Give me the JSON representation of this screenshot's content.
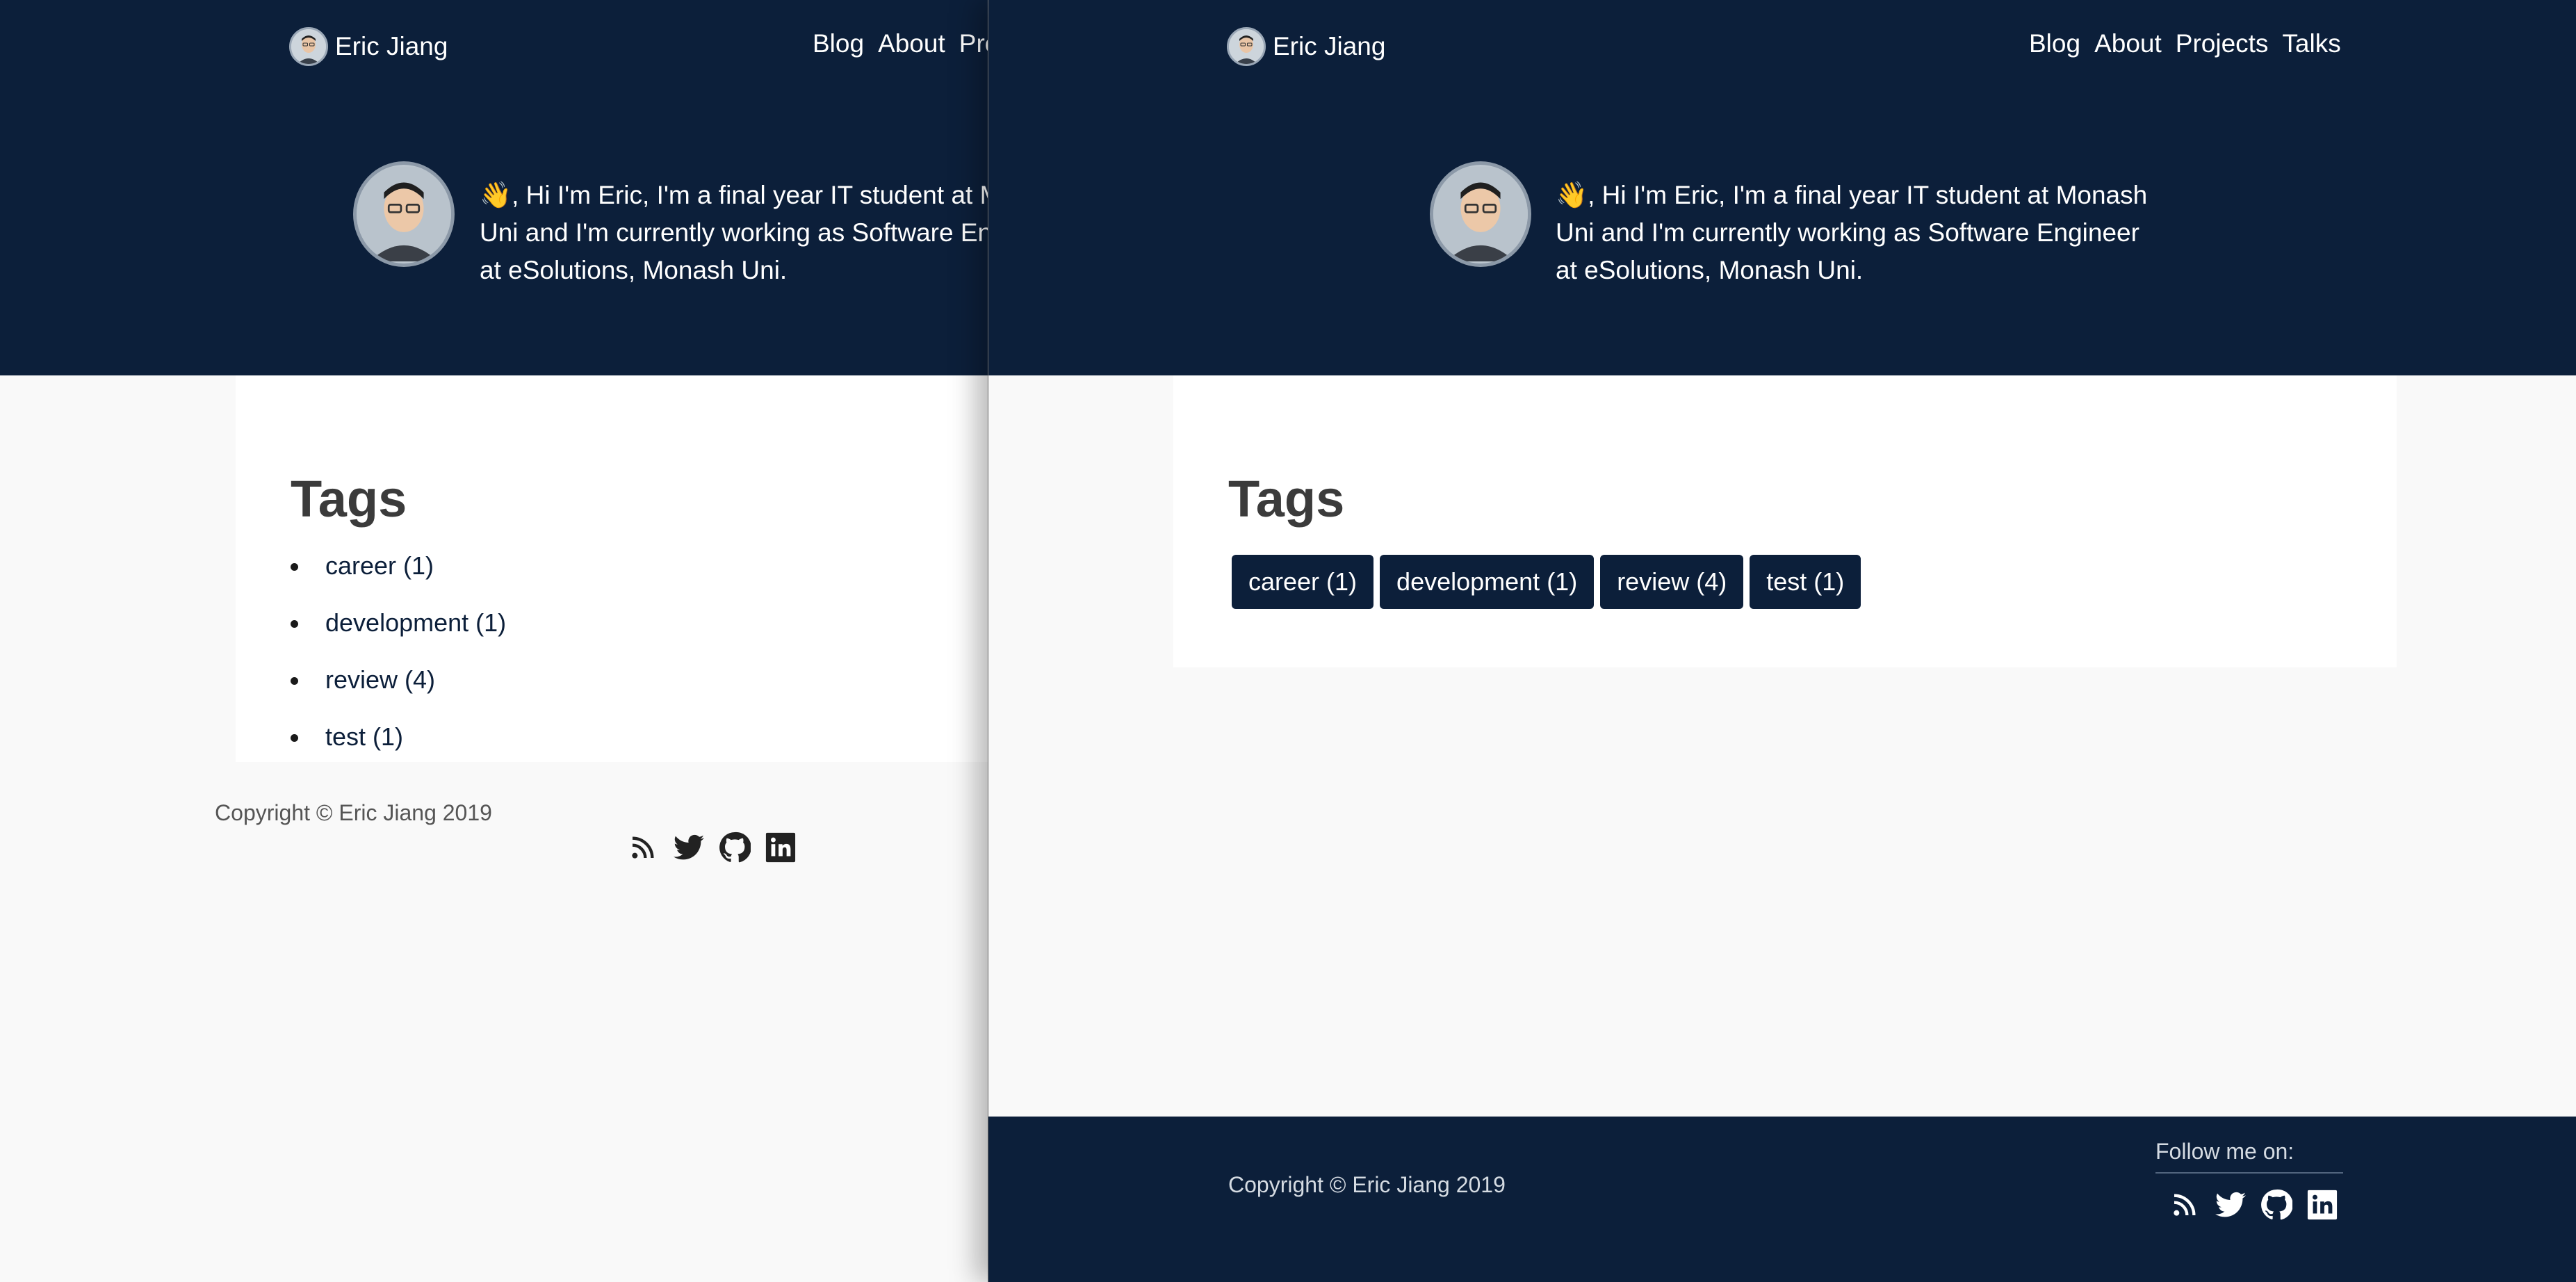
{
  "brand": {
    "name": "Eric Jiang"
  },
  "nav": {
    "before": [
      "Blog",
      "About",
      "Pro"
    ],
    "after": [
      "Blog",
      "About",
      "Projects",
      "Talks"
    ]
  },
  "intro": {
    "wave": "👋",
    "before_lines": [
      ", Hi I'm Eric, I'm a final year IT student at M",
      "Uni and I'm currently working as Software Eng",
      "at eSolutions, Monash Uni."
    ],
    "after_lines": [
      ", Hi I'm Eric, I'm a final year IT student at Monash",
      "Uni and I'm currently working as Software Engineer",
      "at eSolutions, Monash Uni."
    ]
  },
  "tags": {
    "title": "Tags",
    "items": [
      "career (1)",
      "development (1)",
      "review (4)",
      "test (1)"
    ]
  },
  "footer": {
    "copyright": "Copyright © Eric Jiang 2019",
    "follow_label": "Follow me on:",
    "social_icons": [
      "rss-icon",
      "twitter-icon",
      "github-icon",
      "linkedin-icon"
    ]
  },
  "colors": {
    "navy": "#0c1f3a",
    "page_bg": "#f9f9f9",
    "card_bg": "#ffffff",
    "heading": "#3b3b3b"
  }
}
